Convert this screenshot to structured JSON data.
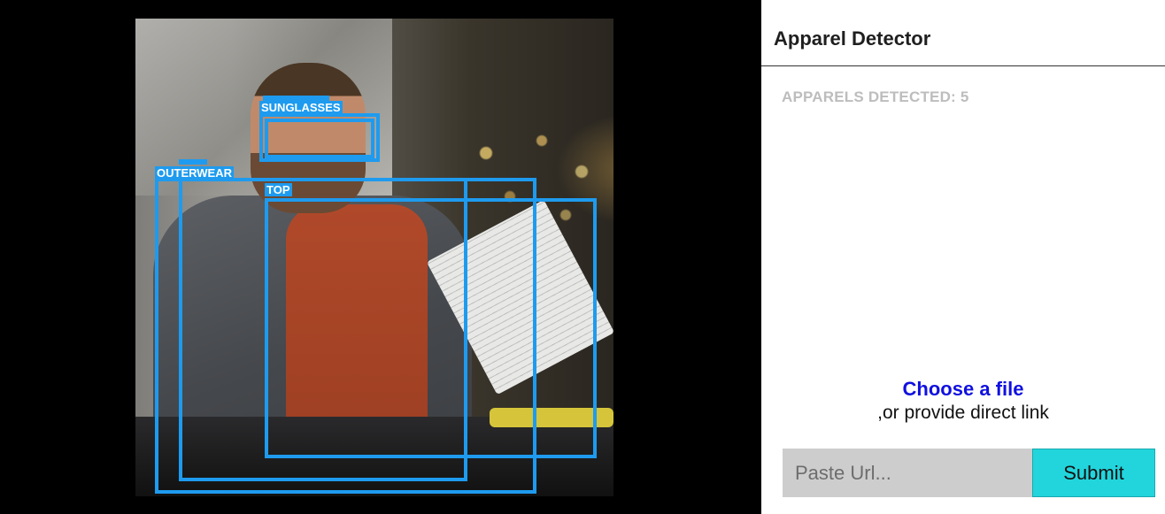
{
  "app": {
    "title": "Apparel Detector"
  },
  "results": {
    "count_label": "APPARELS DETECTED: 5"
  },
  "detections": {
    "sunglasses": "SUNGLASSES",
    "outerwear": "OUTERWEAR",
    "top": "TOP"
  },
  "upload": {
    "choose_file": "Choose a file",
    "or_text": ",or provide direct link",
    "url_placeholder": "Paste Url...",
    "submit_label": "Submit"
  },
  "colors": {
    "box": "#1e9bef",
    "submit_bg": "#22d5dc",
    "link": "#1010e0"
  }
}
